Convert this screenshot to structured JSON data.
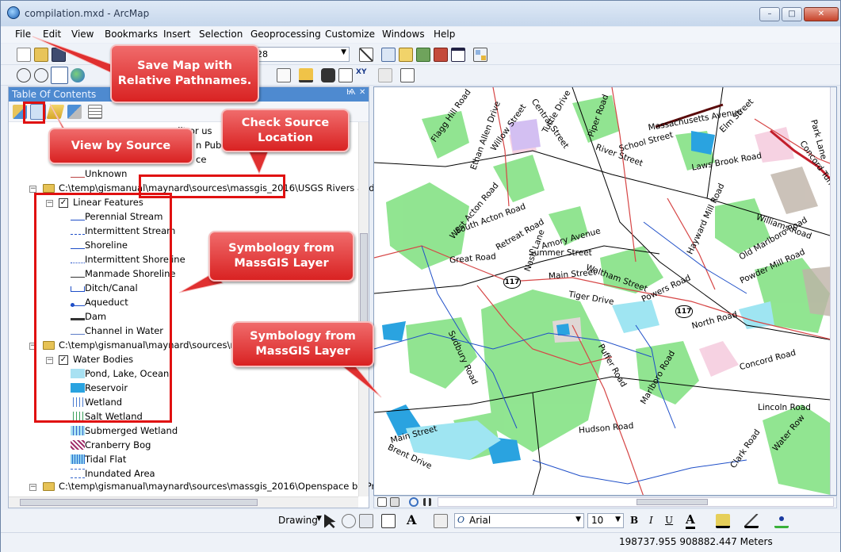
{
  "window": {
    "title": "compilation.mxd - ArcMap",
    "minimize": "–",
    "maximize": "□",
    "close": "✕"
  },
  "menu": [
    "File",
    "Edit",
    "View",
    "Bookmarks",
    "Insert",
    "Selection",
    "Geoprocessing",
    "Customize",
    "Windows",
    "Help"
  ],
  "toolbar": {
    "scale_value": "28"
  },
  "toc": {
    "title": "Table Of Contents",
    "pin": "Ѩ",
    "close": "✕",
    "partial_1": "uilt or us",
    "partial_2": "n Pub",
    "partial_3": "ce",
    "unknown": "Unknown",
    "group1_path": "C:\\temp\\gismanual\\maynard\\sources\\massgis_2016\\USGS Rivers and S",
    "layer_linear": "Linear Features",
    "linear_items": [
      "Perennial Stream",
      "Intermittent Stream",
      "Shoreline",
      "Intermittent Shoreline",
      "Manmade Shoreline",
      "Ditch/Canal",
      "Aqueduct",
      "Dam",
      "Channel in Water"
    ],
    "group2_path": "C:\\temp\\gismanual\\maynard\\sources\\m",
    "layer_water": "Water Bodies",
    "water_items": [
      "Pond, Lake, Ocean",
      "Reservoir",
      "Wetland",
      "Salt Wetland",
      "Submerged Wetland",
      "Cranberry Bog",
      "Tidal Flat",
      "Inundated Area"
    ],
    "group3_path": "C:\\temp\\gismanual\\maynard\\sources\\massgis_2016\\Openspace by Pri"
  },
  "callouts": {
    "save_map": "Save Map with Relative Pathnames.",
    "view_source": "View by Source",
    "check_source": "Check Source Location",
    "symbology_1": "Symbology from MassGIS Layer",
    "symbology_2": "Symbology from MassGIS Layer"
  },
  "map_labels": {
    "flagg_hill": "Flagg Hill Road",
    "ethan_allen": "Ethan Allen Drive",
    "willow": "Willow Street",
    "central": "Central Street",
    "tuttle": "Tuttle Drive",
    "piper": "Piper Road",
    "massachusetts": "Massachusetts Avenue",
    "elm": "Elm Street",
    "park_lane": "Park Lane",
    "school": "School Street",
    "river": "River Street",
    "laws_brook": "Laws Brook Road",
    "concord_tpke": "Concord Turnpike",
    "hayward": "Hayward Mill Road",
    "williams": "Williams Road",
    "old_marlboro": "Old Marlboro Road",
    "powder_mill": "Powder Mill Road",
    "west_acton": "West Acton Road",
    "south_acton": "South Acton Road",
    "retreat": "Retreat Road",
    "nash": "Nash Lane",
    "amory": "Amory Avenue",
    "summer": "Summer Street",
    "great": "Great Road",
    "main": "Main Street",
    "waltham": "Waltham Street",
    "powers": "Powers Road",
    "tiger": "Tiger Drive",
    "north": "North Road",
    "hudson": "Hudson Road",
    "concord_road": "Concord Road",
    "lincoln": "Lincoln Road",
    "water_row": "Water Row",
    "clark": "Clark Road",
    "marlboro": "Marlboro Road",
    "brent": "Brent Drive",
    "main2": "Main Street",
    "puffer": "Puffer Road",
    "sudbury": "Sudbury Road",
    "route_117a": "117",
    "route_117b": "117"
  },
  "drawing": {
    "label": "Drawing",
    "font": "Arial",
    "size": "10",
    "bold": "B",
    "italic": "I",
    "underline": "U",
    "font_color": "A"
  },
  "status": {
    "coords": "198737.955  908882.447 Meters"
  }
}
